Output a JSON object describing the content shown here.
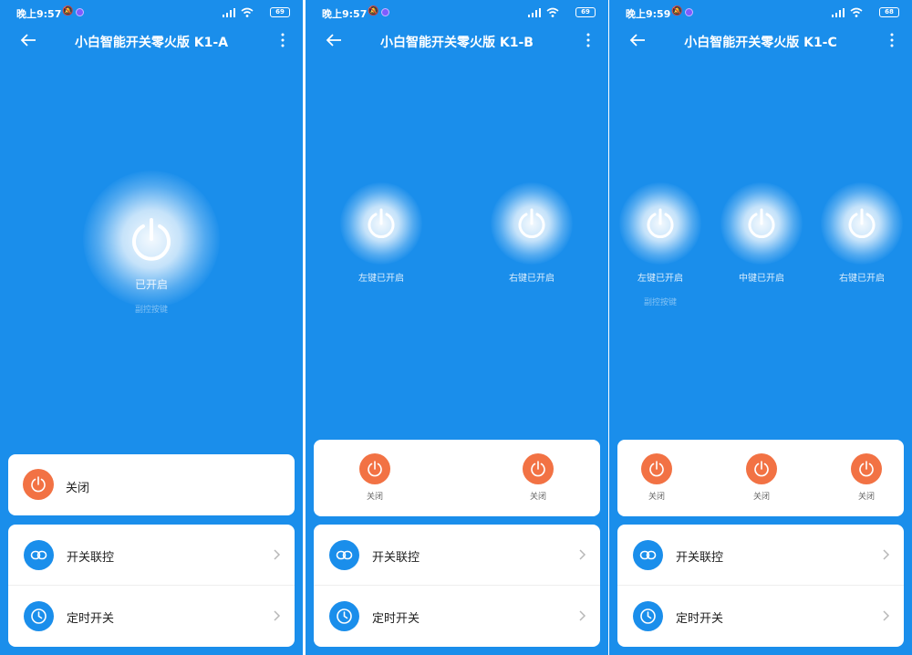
{
  "screens": [
    {
      "status": {
        "time": "晚上9:57",
        "battery": "69"
      },
      "title": "小白智能开关零火版 K1-A",
      "switches": [
        {
          "state_label": "已开启",
          "sub_label": "副控按键"
        }
      ],
      "control_label": "关闭",
      "menu": [
        {
          "label": "开关联控",
          "icon": "link-icon"
        },
        {
          "label": "定时开关",
          "icon": "clock-icon"
        }
      ]
    },
    {
      "status": {
        "time": "晚上9:57",
        "battery": "69"
      },
      "title": "小白智能开关零火版 K1-B",
      "switches": [
        {
          "state_label": "左键已开启"
        },
        {
          "state_label": "右键已开启"
        }
      ],
      "controls": [
        {
          "label": "关闭"
        },
        {
          "label": "关闭"
        }
      ],
      "menu": [
        {
          "label": "开关联控",
          "icon": "link-icon"
        },
        {
          "label": "定时开关",
          "icon": "clock-icon"
        }
      ]
    },
    {
      "status": {
        "time": "晚上9:59",
        "battery": "68"
      },
      "title": "小白智能开关零火版 K1-C",
      "switches": [
        {
          "state_label": "左键已开启",
          "sub_label": "副控按键"
        },
        {
          "state_label": "中键已开启"
        },
        {
          "state_label": "右键已开启"
        }
      ],
      "controls": [
        {
          "label": "关闭"
        },
        {
          "label": "关闭"
        },
        {
          "label": "关闭"
        }
      ],
      "menu": [
        {
          "label": "开关联控",
          "icon": "link-icon"
        },
        {
          "label": "定时开关",
          "icon": "clock-icon"
        }
      ]
    }
  ],
  "colors": {
    "background": "#1a8eeb",
    "off_button": "#f27244",
    "menu_icon_bg": "#1a8eeb"
  }
}
